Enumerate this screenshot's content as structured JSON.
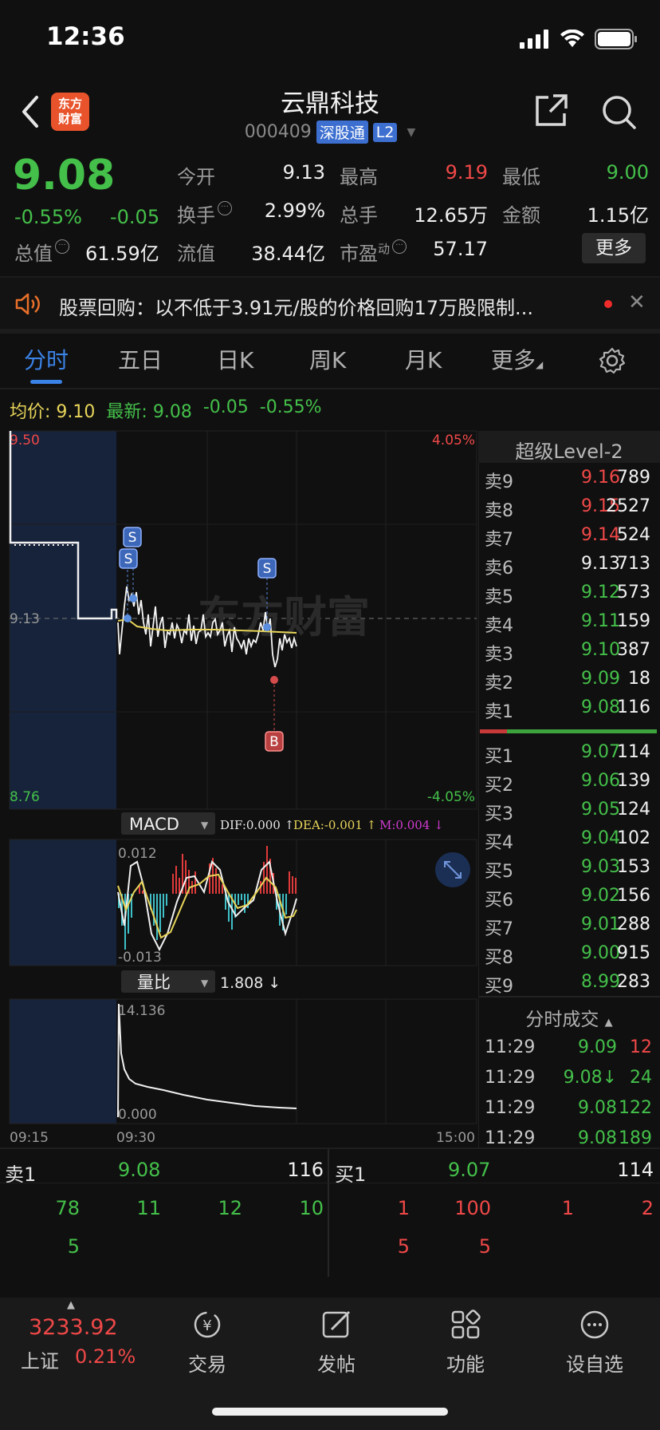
{
  "status": {
    "time": "12:36"
  },
  "header": {
    "logo_line1": "东方",
    "logo_line2": "财富",
    "stock_name": "云鼎科技",
    "stock_code": "000409",
    "tag_exchange": "深股通",
    "tag_level": "L2"
  },
  "quote": {
    "price": "9.08",
    "pct_change": "-0.55%",
    "abs_change": "-0.05",
    "open_label": "今开",
    "open": "9.13",
    "high_label": "最高",
    "high": "9.19",
    "low_label": "最低",
    "low": "9.00",
    "turnover_label": "换手",
    "turnover": "2.99%",
    "volume_label": "总手",
    "volume": "12.65万",
    "amount_label": "金额",
    "amount": "1.15亿",
    "mktcap_label": "总值",
    "mktcap": "61.59亿",
    "float_label": "流值",
    "float_cap": "38.44亿",
    "pe_label": "市盈",
    "pe_sup": "动",
    "pe": "57.17",
    "more_label": "更多"
  },
  "notice": {
    "text": "股票回购：以不低于3.91元/股的价格回购17万股限制..."
  },
  "tabs": {
    "t1": "分时",
    "t2": "五日",
    "t3": "日K",
    "t4": "周K",
    "t5": "月K",
    "t6": "更多"
  },
  "avg_row": {
    "avg_label": "均价:",
    "avg": "9.10",
    "last_label": "最新:",
    "last": "9.08",
    "chg": "-0.05",
    "pct": "-0.55%"
  },
  "chart": {
    "y_top": "9.50",
    "y_mid": "9.13",
    "y_bottom": "8.76",
    "pct_top": "4.05%",
    "pct_bottom": "-4.05%",
    "watermark": "东方财富",
    "marker_s": "S",
    "marker_b": "B",
    "macd_label": "MACD",
    "dif": "DIF:0.000 ↑",
    "dea": "DEA:-0.001 ↑",
    "m": "M:0.004 ↓",
    "macd_top": "0.012",
    "macd_bottom": "-0.013",
    "vr_label": "量比",
    "vr_value": "1.808 ↓",
    "vr_top": "14.136",
    "vr_bottom": "0.000",
    "t_start": "09:15",
    "t_open": "09:30",
    "t_end": "15:00",
    "colors": {
      "price_line": "#ffffff",
      "avg_line": "#e8d55a",
      "up": "#f04848",
      "down": "#44c04a"
    }
  },
  "level2": {
    "title": "超级Level-2",
    "asks": [
      {
        "label": "卖9",
        "price": "9.16",
        "vol": "789",
        "color": "red"
      },
      {
        "label": "卖8",
        "price": "9.15",
        "vol": "2527",
        "color": "red"
      },
      {
        "label": "卖7",
        "price": "9.14",
        "vol": "524",
        "color": "red"
      },
      {
        "label": "卖6",
        "price": "9.13",
        "vol": "713",
        "color": "white"
      },
      {
        "label": "卖5",
        "price": "9.12",
        "vol": "573",
        "color": "green"
      },
      {
        "label": "卖4",
        "price": "9.11",
        "vol": "159",
        "color": "green"
      },
      {
        "label": "卖3",
        "price": "9.10",
        "vol": "387",
        "color": "green"
      },
      {
        "label": "卖2",
        "price": "9.09",
        "vol": "18",
        "color": "green"
      },
      {
        "label": "卖1",
        "price": "9.08",
        "vol": "116",
        "color": "green"
      }
    ],
    "bids": [
      {
        "label": "买1",
        "price": "9.07",
        "vol": "114"
      },
      {
        "label": "买2",
        "price": "9.06",
        "vol": "139"
      },
      {
        "label": "买3",
        "price": "9.05",
        "vol": "124"
      },
      {
        "label": "买4",
        "price": "9.04",
        "vol": "102"
      },
      {
        "label": "买5",
        "price": "9.03",
        "vol": "153"
      },
      {
        "label": "买6",
        "price": "9.02",
        "vol": "156"
      },
      {
        "label": "买7",
        "price": "9.01",
        "vol": "288"
      },
      {
        "label": "买8",
        "price": "9.00",
        "vol": "915"
      },
      {
        "label": "买9",
        "price": "8.99",
        "vol": "283"
      }
    ],
    "ticks_title": "分时成交",
    "ticks": [
      {
        "time": "11:29",
        "price": "9.09",
        "vol": "12",
        "vcolor": "red"
      },
      {
        "time": "11:29",
        "price": "9.08↓",
        "vol": "24",
        "vcolor": "green"
      },
      {
        "time": "11:29",
        "price": "9.08",
        "vol": "122",
        "vcolor": "green"
      },
      {
        "time": "11:29",
        "price": "9.08",
        "vol": "189",
        "vcolor": "green"
      }
    ]
  },
  "strip": {
    "sell_label": "卖1",
    "sell_price": "9.08",
    "sell_vol": "116",
    "buy_label": "买1",
    "buy_price": "9.07",
    "buy_vol": "114",
    "sell_queue": [
      "78",
      "11",
      "12",
      "10",
      "5"
    ],
    "buy_queue": [
      "1",
      "100",
      "1",
      "2",
      "5",
      "5"
    ]
  },
  "nav": {
    "index_value": "3233.92",
    "index_name": "上证",
    "index_pct": "0.21%",
    "trade": "交易",
    "post": "发帖",
    "func": "功能",
    "watchlist": "设自选"
  }
}
